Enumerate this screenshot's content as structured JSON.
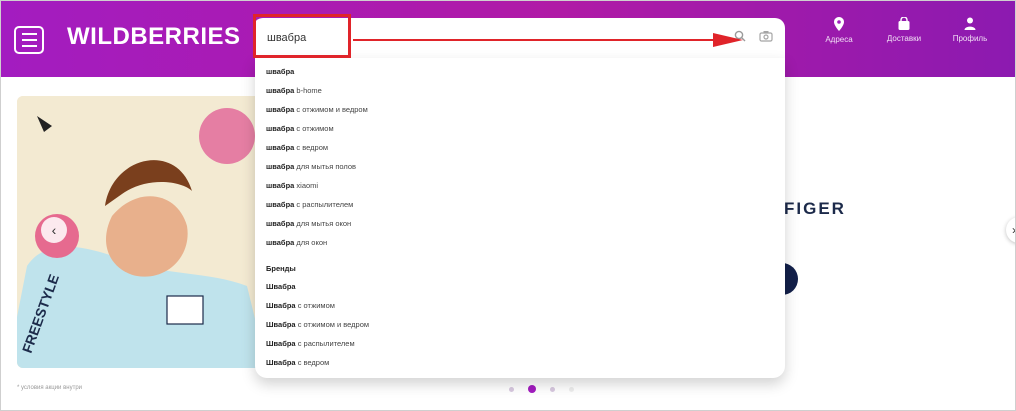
{
  "header": {
    "logo": "WILDBERRIES",
    "search": {
      "value": "швабра"
    },
    "nav": [
      {
        "label": "Адреса",
        "icon": "location-pin-icon"
      },
      {
        "label": "Доставки",
        "icon": "delivery-bag-icon"
      },
      {
        "label": "Профиль",
        "icon": "user-icon"
      }
    ]
  },
  "dropdown": {
    "suggestions": [
      {
        "bold": "швабра",
        "rest": ""
      },
      {
        "bold": "швабра",
        "rest": " b-home"
      },
      {
        "bold": "швабра",
        "rest": " с отжимом и ведром"
      },
      {
        "bold": "швабра",
        "rest": " с отжимом"
      },
      {
        "bold": "швабра",
        "rest": " с ведром"
      },
      {
        "bold": "швабра",
        "rest": " для мытья полов"
      },
      {
        "bold": "швабра",
        "rest": " xiaomi"
      },
      {
        "bold": "швабра",
        "rest": " с распылителем"
      },
      {
        "bold": "швабра",
        "rest": " для мытья окон"
      },
      {
        "bold": "швабра",
        "rest": " для окон"
      }
    ],
    "brands_heading": "Бренды",
    "brands": [
      {
        "bold": "Швабра",
        "rest": ""
      },
      {
        "bold": "Швабра",
        "rest": " с отжимом"
      },
      {
        "bold": "Швабра",
        "rest": " с отжимом и ведром"
      },
      {
        "bold": "Швабра",
        "rest": " с распылителем"
      },
      {
        "bold": "Швабра",
        "rest": " с ведром"
      }
    ]
  },
  "content": {
    "brand_text": "FIGER",
    "footnote": "* условия акции внутри",
    "carousel": {
      "slides": 4,
      "active": 2
    }
  },
  "colors": {
    "header_start": "#a31cc0",
    "header_end": "#8c1ab0",
    "highlight": "#e0242a"
  }
}
